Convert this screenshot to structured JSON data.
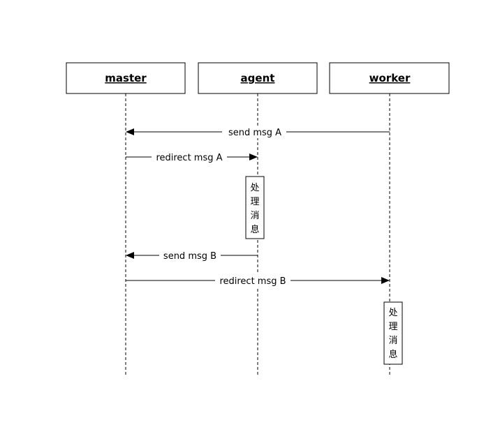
{
  "actors": [
    {
      "id": "master",
      "label": "master"
    },
    {
      "id": "agent",
      "label": "agent"
    },
    {
      "id": "worker",
      "label": "worker"
    }
  ],
  "messages": [
    {
      "from": "worker",
      "to": "master",
      "label": "send msg A"
    },
    {
      "from": "master",
      "to": "agent",
      "label": "redirect msg A"
    },
    {
      "from": "agent",
      "to": "master",
      "label": "send msg B"
    },
    {
      "from": "master",
      "to": "worker",
      "label": "redirect msg B"
    }
  ],
  "notes": [
    {
      "actor": "agent",
      "text": "处理消息"
    },
    {
      "actor": "worker",
      "text": "处理消息"
    }
  ]
}
